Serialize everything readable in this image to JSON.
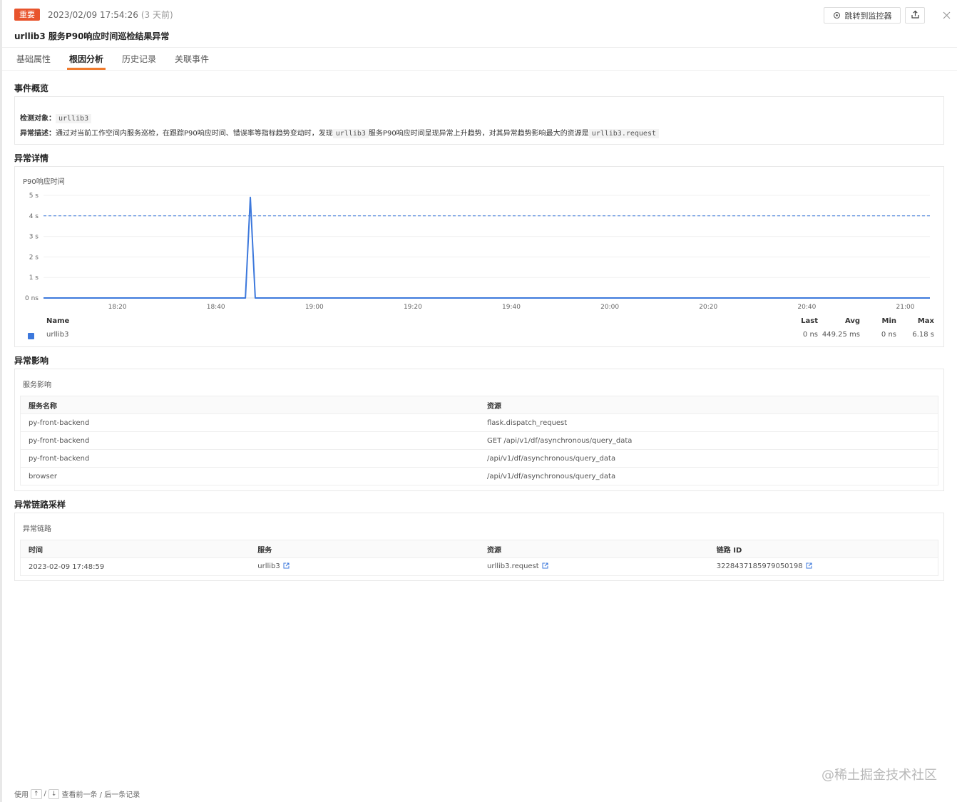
{
  "header": {
    "badge": "重要",
    "time": "2023/02/09 17:54:26",
    "relative": "(3 天前)",
    "title": "urllib3 服务P90响应时间巡检结果异常",
    "monitor_button": "跳转到监控器"
  },
  "tabs": [
    {
      "label": "基础属性",
      "active": false
    },
    {
      "label": "根因分析",
      "active": true
    },
    {
      "label": "历史记录",
      "active": false
    },
    {
      "label": "关联事件",
      "active": false
    }
  ],
  "overview": {
    "section": "事件概览",
    "target_label": "检测对象：",
    "target_value": "urllib3",
    "desc_label": "异常描述：",
    "desc_part1": "通过对当前工作空间内服务巡检，在跟踪P90响应时间、错误率等指标趋势变动时，发现",
    "desc_code1": "urllib3",
    "desc_part2": "服务P90响应时间呈现异常上升趋势，对其异常趋势影响最大的资源是",
    "desc_code2": "urllib3.request"
  },
  "details": {
    "section": "异常详情",
    "chart_title": "P90响应时间"
  },
  "chart_data": {
    "type": "line",
    "title": "P90响应时间",
    "y_ticks": [
      "5 s",
      "4 s",
      "3 s",
      "2 s",
      "1 s",
      "0 ns"
    ],
    "x_ticks": [
      "18:20",
      "18:40",
      "19:00",
      "19:20",
      "19:40",
      "20:00",
      "20:20",
      "20:40",
      "21:00"
    ],
    "ylim": [
      0,
      5
    ],
    "threshold": 4,
    "series": [
      {
        "name": "urllib3",
        "color": "#3c78dc",
        "points": [
          {
            "t": "18:05",
            "v": 0
          },
          {
            "t": "18:46",
            "v": 0
          },
          {
            "t": "18:47",
            "v": 4.9
          },
          {
            "t": "18:48",
            "v": 0
          },
          {
            "t": "21:05",
            "v": 0
          }
        ]
      }
    ],
    "legend": {
      "headers": {
        "name": "Name",
        "last": "Last",
        "avg": "Avg",
        "min": "Min",
        "max": "Max"
      },
      "rows": [
        {
          "name": "urllib3",
          "last": "0 ns",
          "avg": "449.25 ms",
          "min": "0 ns",
          "max": "6.18 s"
        }
      ]
    }
  },
  "impact": {
    "section": "异常影响",
    "subtitle": "服务影响",
    "columns": [
      "服务名称",
      "资源"
    ],
    "rows": [
      [
        "py-front-backend",
        "flask.dispatch_request"
      ],
      [
        "py-front-backend",
        "GET /api/v1/df/asynchronous/query_data"
      ],
      [
        "py-front-backend",
        "/api/v1/df/asynchronous/query_data"
      ],
      [
        "browser",
        "/api/v1/df/asynchronous/query_data"
      ]
    ]
  },
  "traces": {
    "section": "异常链路采样",
    "subtitle": "异常链路",
    "columns": [
      "时间",
      "服务",
      "资源",
      "链路 ID"
    ],
    "rows": [
      [
        "2023-02-09 17:48:59",
        "urllib3",
        "urllib3.request",
        "3228437185979050198"
      ]
    ]
  },
  "footer": {
    "prefix": "使用",
    "up": "↑",
    "sep": "/",
    "down": "↓",
    "suffix": "查看前一条 / 后一条记录"
  },
  "watermark": "@稀土掘金技术社区"
}
